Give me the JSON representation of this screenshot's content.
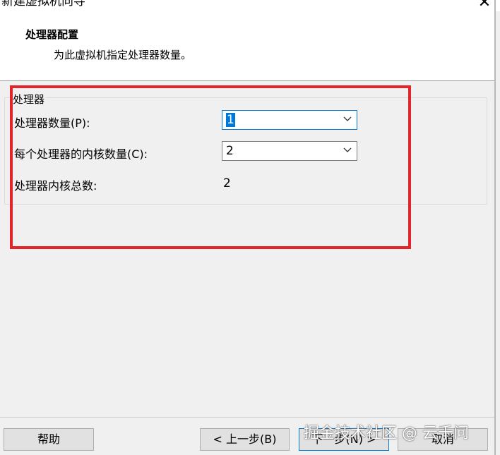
{
  "window": {
    "title": "新建虚拟机向导",
    "close_glyph": "✕"
  },
  "header": {
    "title": "处理器配置",
    "subtitle": "为此虚拟机指定处理器数量。"
  },
  "processor_group": {
    "title": "处理器",
    "cpu_count": {
      "label": "处理器数量(P):",
      "value": "1"
    },
    "cores_per_cpu": {
      "label": "每个处理器的内核数量(C):",
      "value": "2"
    },
    "total_cores": {
      "label": "处理器内核总数:",
      "value": "2"
    }
  },
  "buttons": {
    "help": "帮助",
    "back": "< 上一步(B)",
    "next": "下一步(N) >",
    "cancel": "取消"
  },
  "watermark": "掘金技术社区 @ 云千问",
  "colors": {
    "annotation": "#e3242b",
    "selection": "#0078d7"
  },
  "icons": {
    "dropdown": "chevron-down-icon",
    "close": "close-icon"
  }
}
